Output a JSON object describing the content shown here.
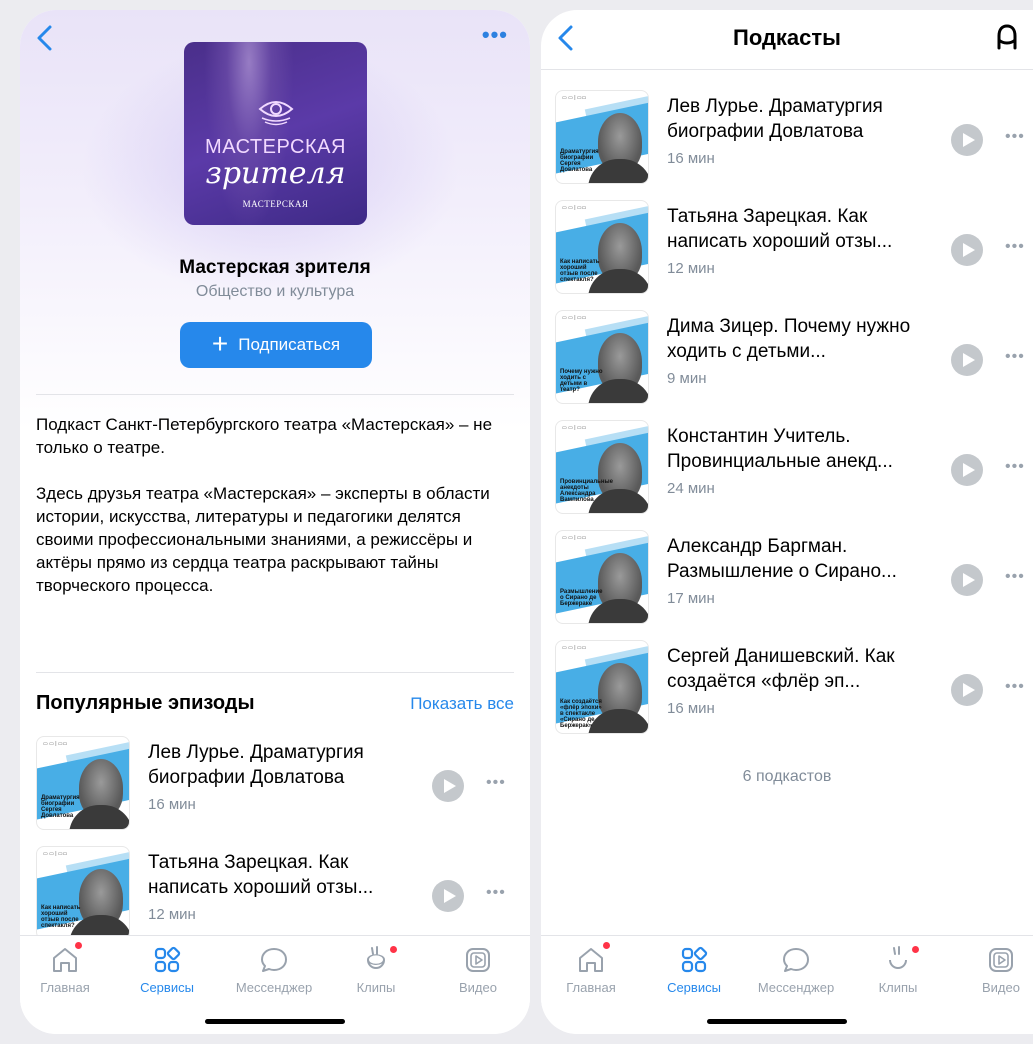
{
  "left": {
    "podcast": {
      "title": "Мастерская зрителя",
      "category": "Общество и культура",
      "cover_line1": "МАСТЕРСКАЯ",
      "cover_line2": "зрителя",
      "cover_line3": "МАСТЕРСКАЯ"
    },
    "subscribe_label": "Подписаться",
    "description": [
      "Подкаст Санкт-Петербургского театра «Мастерская» – не только о театре.",
      "Здесь друзья театра «Мастерская» – эксперты в области истории, искусства, литературы и педагогики делятся своими профессиональными знаниями, а режиссёры и актёры прямо из сердца театра раскрывают тайны творческого процесса."
    ],
    "section_title": "Популярные эпизоды",
    "show_all": "Показать все",
    "episodes": [
      {
        "title": "Лев Лурье. Драматургия биографии Довлатова",
        "duration": "16 мин",
        "caption": "Драматургия биографии Сергея Довлатова"
      },
      {
        "title": "Татьяна Зарецкая. Как написать хороший отзы...",
        "duration": "12 мин",
        "caption": "Как написать хороший отзыв после спектакля?"
      }
    ]
  },
  "right": {
    "title": "Подкасты",
    "episodes": [
      {
        "title": "Лев Лурье. Драматургия биографии Довлатова",
        "duration": "16 мин",
        "caption": "Драматургия биографии Сергея Довлатова"
      },
      {
        "title": "Татьяна Зарецкая. Как написать хороший отзы...",
        "duration": "12 мин",
        "caption": "Как написать хороший отзыв после спектакля?"
      },
      {
        "title": "Дима Зицер. Почему нужно ходить с детьми...",
        "duration": "9 мин",
        "caption": "Почему нужно ходить с детьми в театр?"
      },
      {
        "title": "Константин Учитель. Провинциальные анекд...",
        "duration": "24 мин",
        "caption": "Провинциальные анекдоты Александра Вампилова"
      },
      {
        "title": "Александр Баргман. Размышление о Сирано...",
        "duration": "17 мин",
        "caption": "Размышление о Сирано де Бержераке"
      },
      {
        "title": "Сергей Данишевский. Как создаётся «флёр эп...",
        "duration": "16 мин",
        "caption": "Как создаётся «флёр эпохи» в спектакле «Сирано де Бержерак»"
      }
    ],
    "count_text": "6 подкастов"
  },
  "tabbar": {
    "items": [
      {
        "label": "Главная",
        "icon": "home-icon",
        "badge": true
      },
      {
        "label": "Сервисы",
        "icon": "services-icon",
        "active": true
      },
      {
        "label": "Мессенджер",
        "icon": "messenger-icon"
      },
      {
        "label": "Клипы",
        "icon": "clips-icon",
        "badge": true
      },
      {
        "label": "Видео",
        "icon": "video-icon"
      }
    ]
  },
  "colors": {
    "accent": "#2688eb",
    "secondary_text": "#818c99",
    "badge": "#ff3347",
    "cover_bg": "#4a2f8a"
  }
}
